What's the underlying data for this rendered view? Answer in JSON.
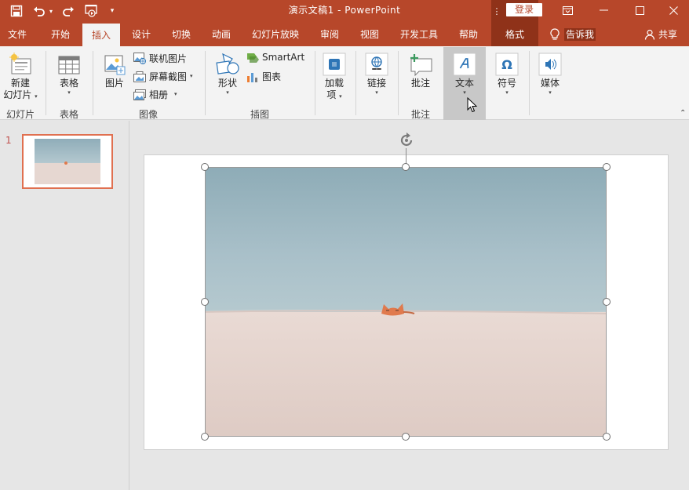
{
  "window": {
    "title": "演示文稿1  -  PowerPoint",
    "login_label": "登录",
    "title_bar_color": "#b7472a"
  },
  "menu": {
    "tabs": [
      "文件",
      "开始",
      "插入",
      "设计",
      "切换",
      "动画",
      "幻灯片放映",
      "审阅",
      "视图",
      "开发工具",
      "帮助",
      "格式"
    ],
    "active_tab": "插入",
    "contextual_tab": "格式",
    "tell_me": "告诉我",
    "share": "共享"
  },
  "ribbon": {
    "new_slide": {
      "line1": "新建",
      "line2": "幻灯片"
    },
    "table": "表格",
    "picture": "图片",
    "online_pictures": "联机图片",
    "screenshot": "屏幕截图",
    "album": "相册",
    "shapes": "形状",
    "smartart": "SmartArt",
    "chart": "图表",
    "addins": {
      "line1": "加载",
      "line2": "项"
    },
    "link": "链接",
    "comment": "批注",
    "text": "文本",
    "symbol": "符号",
    "media": "媒体",
    "groups": {
      "slides": "幻灯片",
      "tables": "表格",
      "images": "图像",
      "illustrations": "插图",
      "comments": "批注"
    }
  },
  "slides_pane": {
    "slide_number": "1"
  },
  "colors": {
    "accent": "#b7472a",
    "contextual": "#8f3219",
    "sky": "#a5bec8",
    "sand": "#e5d6d0",
    "cat": "#e07a4d",
    "thumb_border": "#e07050"
  }
}
